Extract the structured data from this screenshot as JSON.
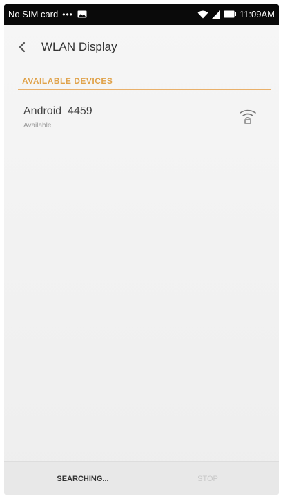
{
  "status_bar": {
    "carrier": "No SIM card",
    "dots": "•••",
    "time": "11:09AM",
    "icons": [
      "image-icon",
      "wifi-icon",
      "signal-icon",
      "battery-icon"
    ]
  },
  "header": {
    "back_icon": "chevron-left-icon",
    "title": "WLAN Display"
  },
  "section": {
    "title": "AVAILABLE DEVICES"
  },
  "devices": [
    {
      "name": "Android_4459",
      "status": "Available",
      "icon": "wireless-display-icon"
    }
  ],
  "footer": {
    "searching_label": "SEARCHING...",
    "stop_label": "STOP"
  },
  "colors": {
    "accent": "#e0a24a",
    "divider": "#e9b06a",
    "status_bar_bg": "#0a0a0a",
    "screen_bg": "#f2f2f2"
  }
}
